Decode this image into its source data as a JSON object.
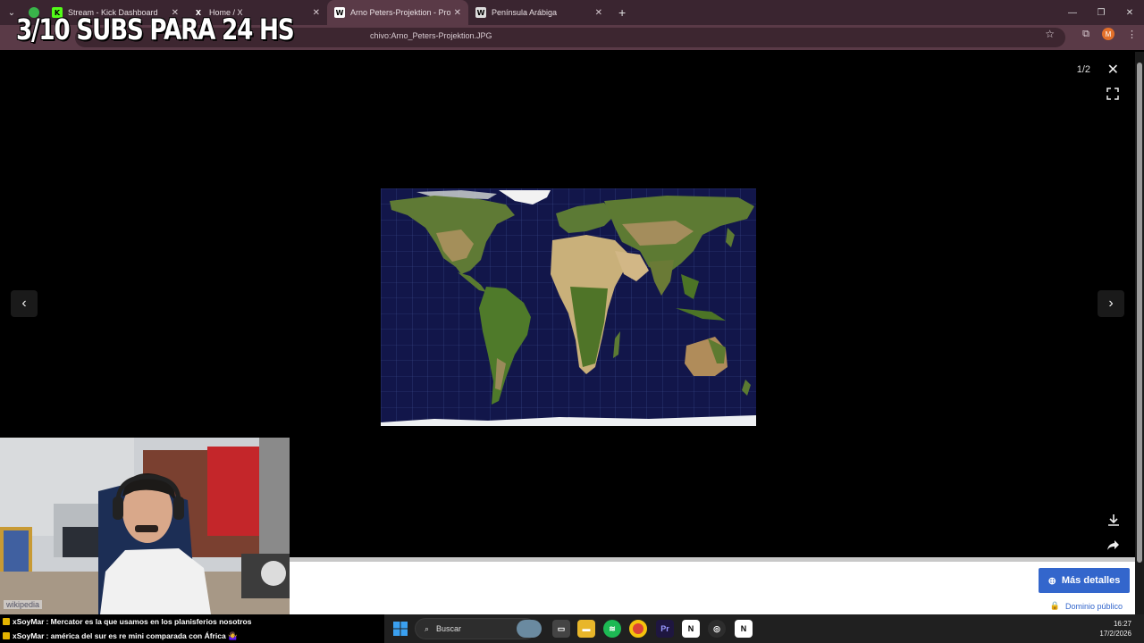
{
  "browser": {
    "tabs": [
      {
        "label": "Stream - Kick Dashboard",
        "icon": "kick-icon",
        "active": false
      },
      {
        "label": "Home / X",
        "icon": "x-icon",
        "active": false
      },
      {
        "label": "Arno Peters-Projektion - Proye",
        "icon": "wikipedia-icon",
        "active": true
      },
      {
        "label": "Península Arábiga",
        "icon": "wikipedia-icon",
        "active": false
      }
    ],
    "url": "chivo:Arno_Peters-Projektion.JPG",
    "profile_initial": "M"
  },
  "overlay": {
    "title": "3/10 SUBS PARA 24 HS"
  },
  "viewer": {
    "counter": "1/2",
    "more_details_label": "Más detalles",
    "license_label": "Dominio público"
  },
  "webcam": {
    "label": "wikipedia"
  },
  "chat": {
    "messages": [
      {
        "user": "xSoyMar",
        "text": ": Mercator es la que usamos en los planisferios nosotros"
      },
      {
        "user": "xSoyMar",
        "text": ": américa del sur es re mini comparada con África 🤷‍♀️"
      }
    ]
  },
  "taskbar": {
    "search_placeholder": "Buscar",
    "time": "16:27",
    "date": "17/2/2026"
  },
  "colors": {
    "accent": "#3366cc",
    "tab_bar": "#3a2530",
    "toolbar": "#5a3a47"
  }
}
